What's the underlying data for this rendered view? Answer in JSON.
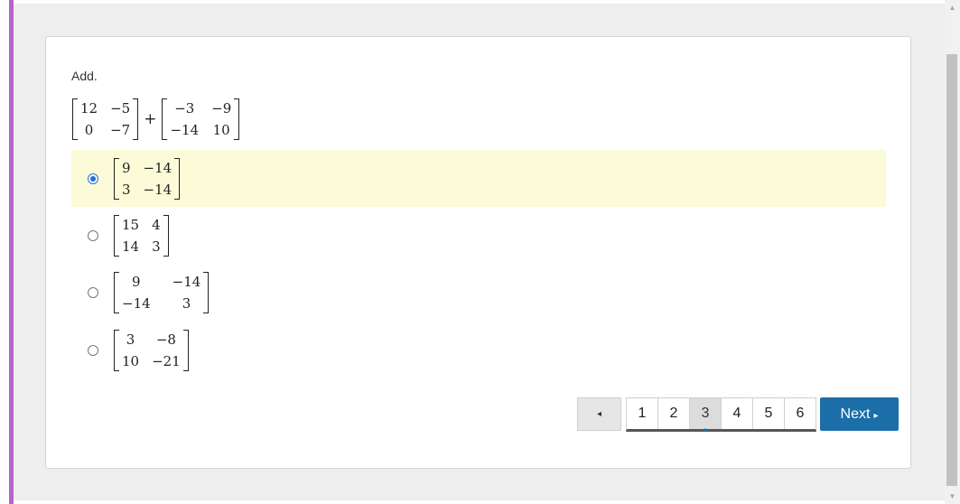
{
  "question": {
    "prompt": "Add.",
    "matrix_a": [
      "12",
      "−5",
      "0",
      "−7"
    ],
    "operator": "+",
    "matrix_b": [
      "−3",
      "−9",
      "−14",
      "10"
    ]
  },
  "options": [
    {
      "selected": true,
      "values": [
        "9",
        "−14",
        "3",
        "−14"
      ]
    },
    {
      "selected": false,
      "values": [
        "15",
        "4",
        "14",
        "3"
      ]
    },
    {
      "selected": false,
      "values": [
        "9",
        "−14",
        "−14",
        "3"
      ]
    },
    {
      "selected": false,
      "values": [
        "3",
        "−8",
        "10",
        "−21"
      ]
    }
  ],
  "pagination": {
    "prev_icon": "◂",
    "pages": [
      "1",
      "2",
      "3",
      "4",
      "5",
      "6"
    ],
    "current": "3",
    "next_label": "Next",
    "next_icon": "▸"
  },
  "colors": {
    "accent": "#b566c8",
    "selected_bg": "#fbfbd8",
    "next_button": "#1b6ea8"
  }
}
